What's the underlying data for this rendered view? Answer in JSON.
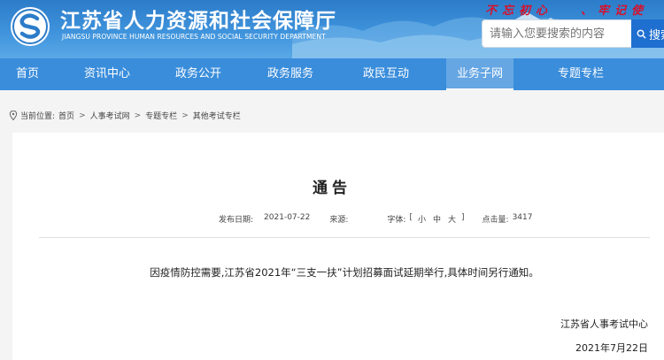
{
  "header": {
    "site_title": "江苏省人力资源和社会保障厅",
    "site_subtitle": "JIANGSU PROVINCE HUMAN RESOURCES AND SOCIAL SECURITY DEPARTMENT",
    "slogan_left": "不忘初心",
    "slogan_right": "、牢记使",
    "search_placeholder": "请输入您要搜索的内容",
    "search_button": "搜索"
  },
  "nav": {
    "items": [
      {
        "label": "首页"
      },
      {
        "label": "资讯中心"
      },
      {
        "label": "政务公开"
      },
      {
        "label": "政务服务"
      },
      {
        "label": "政民互动"
      },
      {
        "label": "业务子网"
      },
      {
        "label": "专题专栏"
      }
    ],
    "active_index": 5
  },
  "breadcrumb": {
    "prefix": "当前位置:",
    "items": [
      "首页",
      "人事考试网",
      "专题专栏",
      "其他考试专栏"
    ],
    "separator": ">"
  },
  "article": {
    "title": "通告",
    "publish_label": "发布日期:",
    "publish_date": "2021-07-22",
    "source_label": "来源:",
    "source_value": "",
    "font_label": "字体:",
    "font_open": "[",
    "font_small": "小",
    "font_medium": "中",
    "font_large": "大",
    "font_close": "]",
    "views_label": "点击量:",
    "views_value": "3417",
    "body": "因疫情防控需要,江苏省2021年“三支一扶”计划招募面试延期举行,具体时间另行通知。",
    "signature_org": "江苏省人事考试中心",
    "signature_date": "2021年7月22日"
  },
  "colors": {
    "header_blue": "#3f93dc",
    "nav_blue": "#3a8ddb",
    "slogan_red": "#d8102a",
    "search_button_blue": "#1f6fd0"
  }
}
